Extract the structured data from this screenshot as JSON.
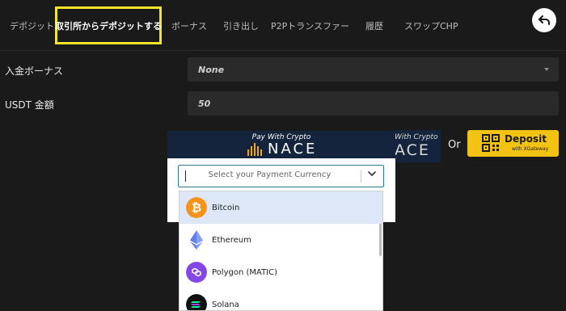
{
  "tabs": [
    {
      "label": "デポジット"
    },
    {
      "label": "取引所からデポジットする"
    },
    {
      "label": "ボーナス"
    },
    {
      "label": "引き出し"
    },
    {
      "label": "P2Pトランスファー"
    },
    {
      "label": "履歴"
    },
    {
      "label": "スワップCHP"
    }
  ],
  "form": {
    "bonus_label": "入金ボーナス",
    "bonus_value": "None",
    "amount_label": "USDT 金額",
    "amount_value": "50"
  },
  "pay_widget": {
    "tagline": "Pay With Crypto",
    "brand": "NACE"
  },
  "bg_widget": {
    "tagline": "With Crypto",
    "brand": "ACE"
  },
  "or_text": "Or",
  "deposit_button": {
    "label": "Deposit",
    "sub": "with XGateway"
  },
  "currency_select": {
    "placeholder": "Select your Payment Currency"
  },
  "currencies": [
    {
      "name": "Bitcoin",
      "color": "#f7931a",
      "icon": "bitcoin-icon"
    },
    {
      "name": "Ethereum",
      "color": "#627eea",
      "icon": "ethereum-icon"
    },
    {
      "name": "Polygon (MATIC)",
      "color": "#8247e5",
      "icon": "polygon-icon"
    },
    {
      "name": "Solana",
      "color": "#111111",
      "icon": "solana-icon"
    }
  ],
  "colors": {
    "highlight_border": "#f5e52a",
    "deposit_yellow": "#f2c313",
    "navy": "#14243d"
  }
}
